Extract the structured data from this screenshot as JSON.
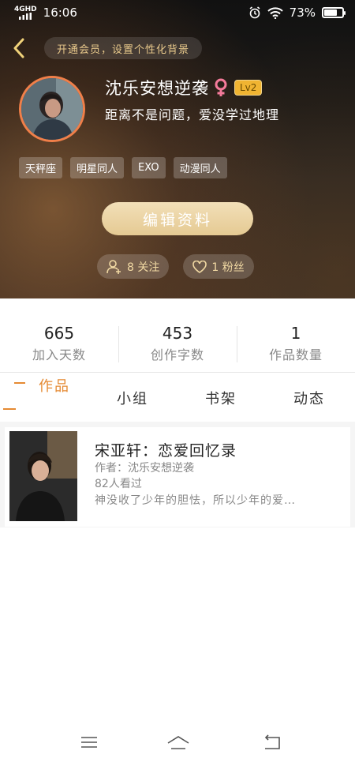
{
  "status": {
    "network": "4GHD",
    "time": "16:06",
    "battery": "73%",
    "battery_level": 0.73
  },
  "header": {
    "vip_prompt": "开通会员，设置个性化背景",
    "username": "沈乐安想逆袭",
    "level": "Lv2",
    "motto": "距离不是问题，爱没学过地理",
    "tags": [
      "天秤座",
      "明星同人",
      "EXO",
      "动漫同人"
    ],
    "edit_label": "编辑资料",
    "follow_label": "8 关注",
    "fans_label": "1 粉丝"
  },
  "stats": [
    {
      "value": "665",
      "label": "加入天数"
    },
    {
      "value": "453",
      "label": "创作字数"
    },
    {
      "value": "1",
      "label": "作品数量"
    }
  ],
  "tabs": [
    "作品",
    "小组",
    "书架",
    "动态"
  ],
  "works": [
    {
      "title": "宋亚轩：恋爱回忆录",
      "author": "作者：沈乐安想逆袭",
      "views": "82人看过",
      "description": "神没收了少年的胆怯，所以少年的爱…"
    }
  ],
  "colors": {
    "accent": "#e58a33",
    "gold": "#e7c88b",
    "avatar_ring": "#f07f49",
    "level_badge": "#f0b432"
  },
  "icons": [
    "back-arrow-icon",
    "female-icon",
    "add-person-icon",
    "heart-icon",
    "alarm-icon",
    "wifi-icon",
    "battery-icon",
    "menu-icon",
    "home-icon",
    "back-icon"
  ]
}
